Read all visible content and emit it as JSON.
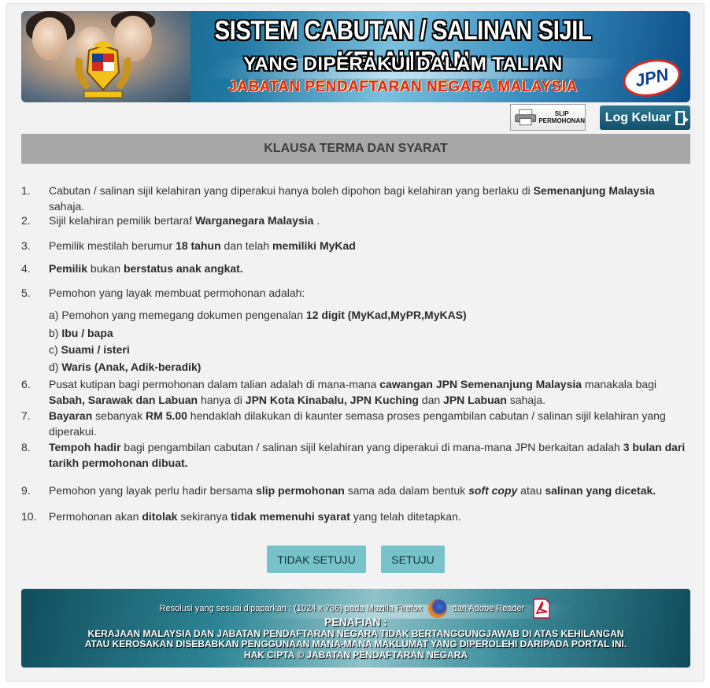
{
  "header": {
    "title_line1": "SISTEM CABUTAN /  SALINAN SIJIL KELAHIRAN",
    "title_line2": "YANG DIPERAKUI DALAM TALIAN",
    "title_line3": "JABATAN PENDAFTARAN NEGARA MALAYSIA",
    "logo_text": "JPN"
  },
  "toolbar": {
    "slip_label_1": "SLIP",
    "slip_label_2": "PERMOHONAN",
    "logout_label": "Log Keluar"
  },
  "section": {
    "title": "KLAUSA TERMA DAN SYARAT"
  },
  "clauses": [
    {
      "num": "1.",
      "html": "Cabutan / salinan sijil kelahiran yang diperakui hanya boleh dipohon bagi kelahiran yang berlaku di <b>Semenanjung Malaysia</b> sahaja."
    },
    {
      "num": "2.",
      "html": "Sijil kelahiran pemilik bertaraf <b>Warganegara Malaysia</b> ."
    },
    {
      "num": "3.",
      "html": "Pemilik mestilah berumur <b>18 tahun</b> dan telah <b>memiliki MyKad</b>"
    },
    {
      "num": "4.",
      "html": "<b>Pemilik</b> bukan <b>berstatus anak angkat.</b>"
    },
    {
      "num": "5.",
      "html": "Pemohon yang layak membuat permohonan adalah:"
    },
    {
      "num": "",
      "html": "a) Pemohon yang memegang dokumen pengenalan <b>12 digit (MyKad,MyPR,MyKAS)</b>"
    },
    {
      "num": "",
      "html": "b) <b>Ibu / bapa</b>"
    },
    {
      "num": "",
      "html": "c) <b>Suami / isteri</b>"
    },
    {
      "num": "",
      "html": "d) <b>Waris (Anak, Adik-beradik)</b>"
    },
    {
      "num": "6.",
      "html": "Pusat kutipan bagi permohonan dalam talian adalah di mana-mana <b>cawangan JPN Semenanjung Malaysia</b> manakala bagi <b>Sabah, Sarawak dan Labuan</b> hanya di <b>JPN Kota Kinabalu, JPN Kuching</b> dan <b>JPN Labuan</b> sahaja."
    },
    {
      "num": "7.",
      "html": "<b>Bayaran</b> sebanyak <b>RM 5.00</b> hendaklah dilakukan di kaunter semasa proses pengambilan cabutan / salinan sijil kelahiran yang diperakui."
    },
    {
      "num": "8.",
      "html": "<b>Tempoh hadir</b> bagi pengambilan cabutan / salinan sijil kelahiran yang diperakui di mana-mana JPN berkaitan adalah <b>3 bulan dari tarikh permohonan dibuat.</b>"
    },
    {
      "num": "9.",
      "html": "Pemohon yang layak perlu hadir bersama <b>slip permohonan</b> sama ada dalam bentuk <b><i>soft copy</i></b> atau <b>salinan yang dicetak.</b>"
    },
    {
      "num": "10.",
      "html": "Permohonan akan <b>ditolak</b> sekiranya <b>tidak memenuhi syarat</b> yang telah ditetapkan."
    }
  ],
  "buttons": {
    "disagree": "TIDAK SETUJU",
    "agree": "SETUJU"
  },
  "footer": {
    "resolution_pre": "Resolusi yang sesuai dipaparkan : (1024 x 786) pada Mozilla Firefox",
    "resolution_post": "dan Adobe Reader",
    "disclaimer_title": "PENAFIAN :",
    "disclaimer_line1": "KERAJAAN MALAYSIA DAN JABATAN PENDAFTARAN NEGARA TIDAK BERTANGGUNGJAWAB DI ATAS KEHILANGAN",
    "disclaimer_line2": "ATAU KEROSAKAN DISEBABKAN PENGGUNAAN MANA-MANA MAKLUMAT YANG DIPEROLEHI DARIPADA PORTAL INI.",
    "copyright": "HAK CIPTA ©  JABATAN PENDAFTARAN NEGARA"
  },
  "colors": {
    "section_header_bg": "#a8a8a8",
    "button_bg": "#78c3c9",
    "title_red": "#e6251a",
    "logout_bg": "#12506b"
  }
}
